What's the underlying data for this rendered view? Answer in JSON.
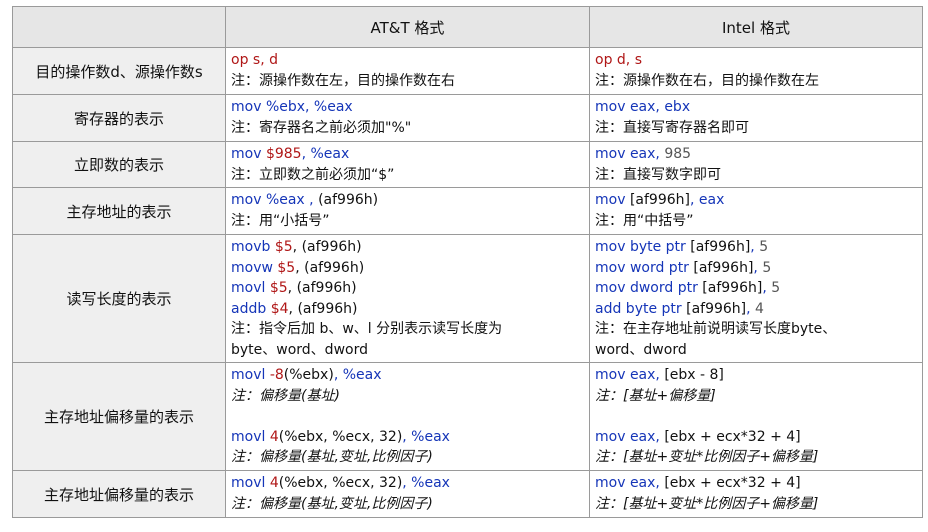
{
  "header": {
    "col1": "",
    "col2": "AT&T 格式",
    "col3": "Intel 格式"
  },
  "rows": [
    {
      "label": "目的操作数d、源操作数s",
      "att": {
        "l1": [
          "op s, d"
        ],
        "note": "注：源操作数在左，目的操作数在右"
      },
      "intel": {
        "l1": [
          "op d, s"
        ],
        "note": "注：源操作数在右，目的操作数在左"
      }
    },
    {
      "label": "寄存器的表示",
      "att": {
        "l1": [
          "mov %ebx, %eax"
        ],
        "note": "注：寄存器名之前必须加\"%\""
      },
      "intel": {
        "l1": [
          "mov eax, ebx"
        ],
        "note": "注：直接写寄存器名即可"
      }
    },
    {
      "label": "立即数的表示",
      "att": {
        "l1": [
          "mov ",
          "$985",
          ", %eax"
        ],
        "note": "注：立即数之前必须加“$”"
      },
      "intel": {
        "l1": [
          "mov eax, ",
          "985"
        ],
        "note": "注：直接写数字即可"
      }
    },
    {
      "label": "主存地址的表示",
      "att": {
        "l1": [
          "mov %eax , ",
          "(af996h)"
        ],
        "note": "注：用“小括号”"
      },
      "intel": {
        "l1": [
          "mov ",
          "[af996h]",
          ", eax"
        ],
        "note": "注：用“中括号”"
      }
    },
    {
      "label": "读写长度的表示",
      "att": {
        "lines": [
          [
            "movb ",
            "$5",
            ", ",
            "(af996h)"
          ],
          [
            "movw ",
            "$5",
            ", ",
            "(af996h)"
          ],
          [
            "movl ",
            "$5",
            ", ",
            "(af996h)"
          ],
          [
            "addb ",
            "$4",
            ", ",
            "(af996h)"
          ]
        ],
        "note1": "注：指令后加 b、w、l 分别表示读写长度为",
        "note2": "byte、word、dword"
      },
      "intel": {
        "lines": [
          [
            "mov byte ptr ",
            "[af996h]",
            ", ",
            "5"
          ],
          [
            "mov word ptr ",
            "[af996h]",
            ", ",
            "5"
          ],
          [
            "mov dword ptr ",
            "[af996h]",
            ", ",
            "5"
          ],
          [
            "add byte ptr ",
            "[af996h]",
            ", ",
            "4"
          ]
        ],
        "note1": "注：在主存地址前说明读写长度byte、",
        "note2": "word、dword"
      }
    },
    {
      "label": "主存地址偏移量的表示",
      "att": {
        "c1": [
          "movl ",
          "-8",
          "(%ebx)",
          ", %eax"
        ],
        "n1": "注：偏移量(基址)",
        "c2": [
          "movl ",
          "4",
          "(%ebx, %ecx, 32)",
          ", %eax"
        ],
        "n2": "注：偏移量(基址,变址,比例因子)"
      },
      "intel": {
        "c1": [
          "mov eax, ",
          "[ebx - 8]"
        ],
        "n1": "注：[基址+偏移量]",
        "c2": [
          "mov eax, ",
          "[ebx + ecx*32 + 4]"
        ],
        "n2": "注：[基址+变址*比例因子+偏移量]"
      }
    },
    {
      "label": "主存地址偏移量的表示",
      "att": {
        "c1": [
          "movl ",
          "4",
          "(%ebx, %ecx, 32)",
          ", %eax"
        ],
        "n1": "注：偏移量(基址,变址,比例因子)"
      },
      "intel": {
        "c1": [
          "mov eax, ",
          "[ebx + ecx*32 + 4]"
        ],
        "n1": "注：[基址+变址*比例因子+偏移量]"
      }
    }
  ]
}
